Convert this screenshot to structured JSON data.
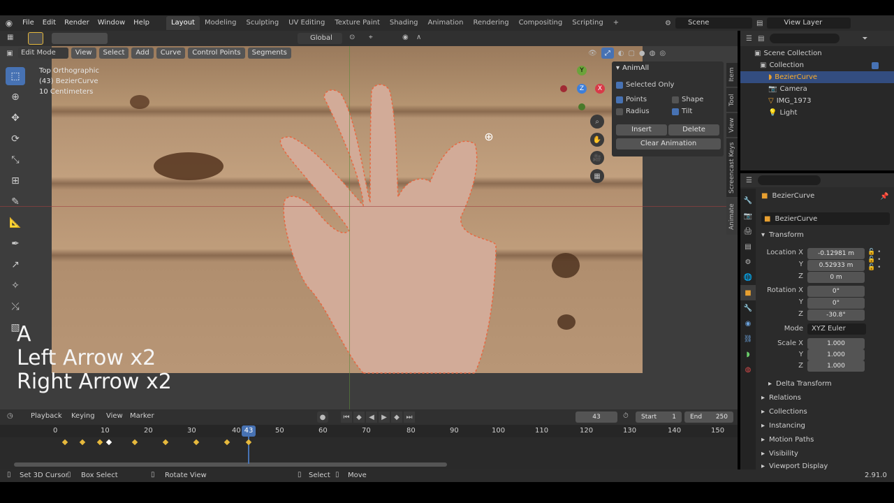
{
  "menubar": {
    "items": [
      "File",
      "Edit",
      "Render",
      "Window",
      "Help"
    ],
    "workspaces": [
      "Layout",
      "Modeling",
      "Sculpting",
      "UV Editing",
      "Texture Paint",
      "Shading",
      "Animation",
      "Rendering",
      "Compositing",
      "Scripting"
    ],
    "active_workspace": "Layout",
    "add_workspace": "+",
    "scene_label": "Scene",
    "view_layer_label": "View Layer"
  },
  "viewport_header": {
    "transform_orientation": "Global"
  },
  "edit_header": {
    "mode": "Edit Mode",
    "menus": [
      "View",
      "Select",
      "Add",
      "Curve",
      "Control Points",
      "Segments"
    ]
  },
  "viewport_info": {
    "line1": "Top Orthographic",
    "line2": "(43) BezierCurve",
    "line3": "10 Centimeters"
  },
  "screencast": {
    "key": "A",
    "line1": "Left Arrow x2",
    "line2": "Right Arrow x2"
  },
  "gizmo": {
    "y": "Y",
    "z": "Z",
    "x": "X"
  },
  "animall": {
    "title": "AnimAll",
    "selected_only": "Selected Only",
    "points": "Points",
    "shape": "Shape",
    "radius": "Radius",
    "tilt": "Tilt",
    "insert": "Insert",
    "delete": "Delete",
    "clear": "Clear Animation"
  },
  "side_tabs": [
    "Item",
    "Tool",
    "View",
    "Screencast Keys",
    "Animate"
  ],
  "timeline": {
    "menus": [
      "Playback",
      "Keying",
      "View",
      "Marker"
    ],
    "current_frame": "43",
    "start_label": "Start",
    "start": "1",
    "end_label": "End",
    "end": "250",
    "ticks": [
      "0",
      "10",
      "20",
      "30",
      "40",
      "50",
      "60",
      "70",
      "80",
      "90",
      "100",
      "110",
      "120",
      "130",
      "140",
      "150"
    ],
    "playhead": "43"
  },
  "outliner": {
    "items": [
      {
        "label": "Scene Collection"
      },
      {
        "label": "Collection"
      },
      {
        "label": "BezierCurve"
      },
      {
        "label": "Camera"
      },
      {
        "label": "IMG_1973"
      },
      {
        "label": "Light"
      }
    ]
  },
  "properties": {
    "object_name": "BezierCurve",
    "data_name": "BezierCurve",
    "transform_title": "Transform",
    "location": {
      "label": "Location X",
      "x": "-0.12981 m",
      "y": "0.52933 m",
      "z": "0 m"
    },
    "rotation": {
      "label": "Rotation X",
      "x": "0°",
      "y": "0°",
      "z": "-30.8°"
    },
    "mode_label": "Mode",
    "mode_value": "XYZ Euler",
    "scale": {
      "label": "Scale X",
      "x": "1.000",
      "y": "1.000",
      "z": "1.000"
    },
    "axis_y": "Y",
    "axis_z": "Z",
    "sections": [
      "Delta Transform",
      "Relations",
      "Collections",
      "Instancing",
      "Motion Paths",
      "Visibility",
      "Viewport Display"
    ]
  },
  "statusbar": {
    "items": [
      "Set 3D Cursor",
      "Box Select",
      "Rotate View",
      "Select",
      "Move"
    ],
    "version": "2.91.0"
  },
  "colors": {
    "accent": "#4772b3",
    "keyframe": "#e6b93d",
    "playhead": "#4772b3"
  }
}
